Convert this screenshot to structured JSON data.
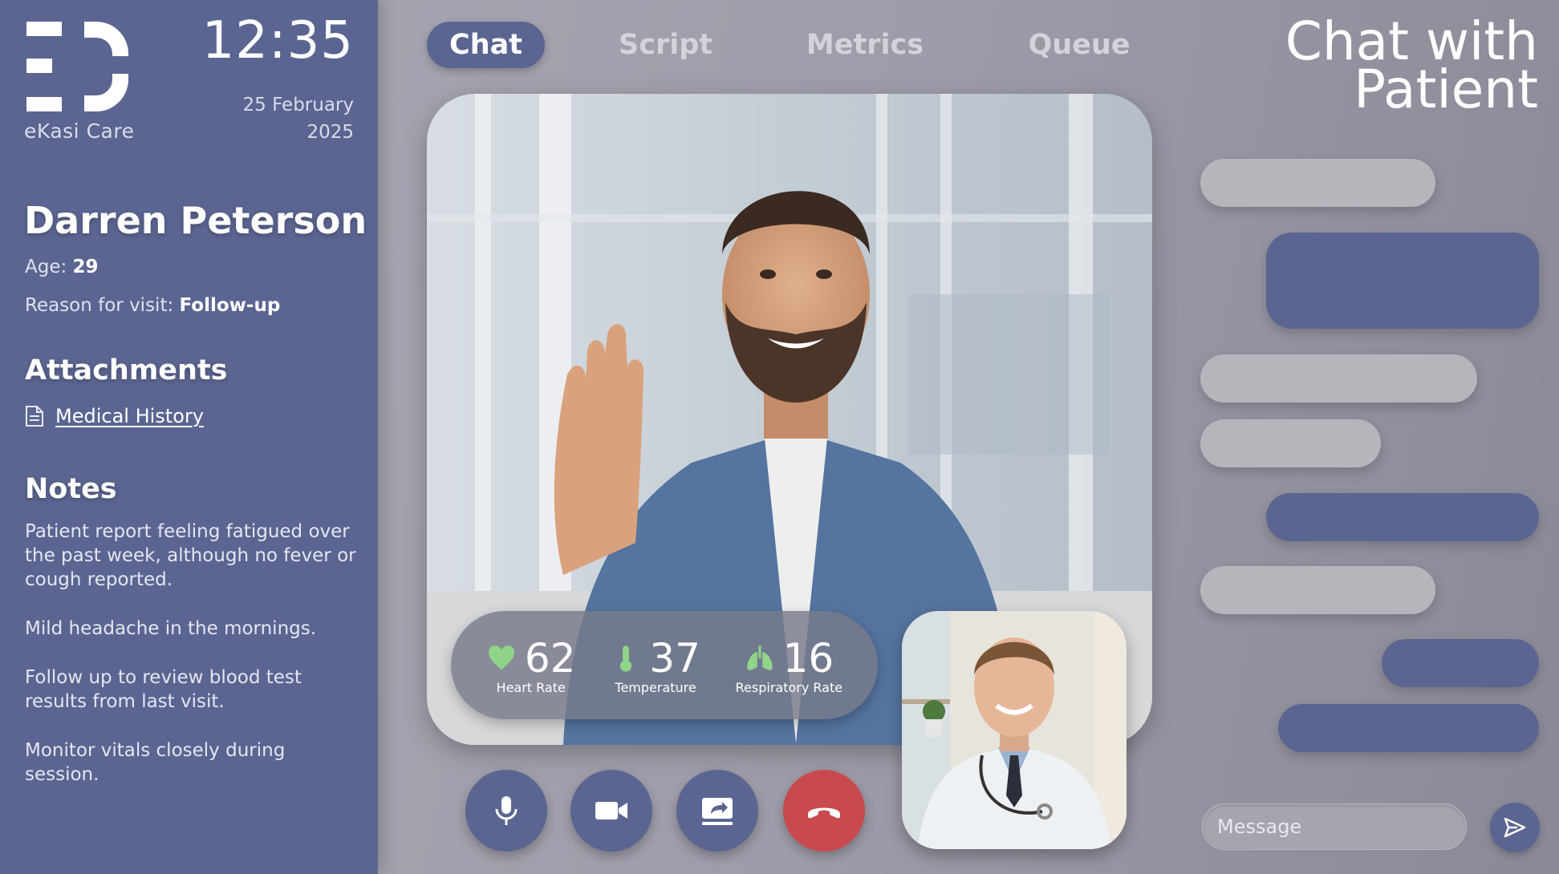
{
  "brand": {
    "name": "eKasi Care"
  },
  "clock": {
    "time": "12:35",
    "date_line1": "25 February",
    "date_line2": "2025"
  },
  "patient": {
    "name": "Darren Peterson",
    "age_label": "Age:",
    "age": "29",
    "reason_label": "Reason for visit:",
    "reason": "Follow-up"
  },
  "attachments": {
    "title": "Attachments",
    "items": [
      {
        "label": "Medical History",
        "icon": "document-icon"
      }
    ]
  },
  "notes": {
    "title": "Notes",
    "items": [
      "Patient report feeling fatigued over the past week, although no fever or cough reported.",
      "Mild headache in the mornings.",
      "Follow up to review blood test results from last visit.",
      "Monitor vitals closely during session."
    ]
  },
  "tabs": [
    {
      "label": "Chat",
      "active": true
    },
    {
      "label": "Script",
      "active": false
    },
    {
      "label": "Metrics",
      "active": false
    },
    {
      "label": "Queue",
      "active": false
    }
  ],
  "page_title": {
    "line1": "Chat with",
    "line2": "Patient"
  },
  "vitals": [
    {
      "label": "Heart Rate",
      "value": "62",
      "icon": "heart-icon"
    },
    {
      "label": "Temperature",
      "value": "37",
      "icon": "thermometer-icon"
    },
    {
      "label": "Respiratory Rate",
      "value": "16",
      "icon": "lungs-icon"
    }
  ],
  "controls": [
    {
      "name": "microphone",
      "icon": "microphone-icon"
    },
    {
      "name": "camera",
      "icon": "video-camera-icon"
    },
    {
      "name": "share-screen",
      "icon": "share-screen-icon"
    },
    {
      "name": "end-call",
      "icon": "hang-up-icon"
    }
  ],
  "chat": {
    "input_placeholder": "Message",
    "send_icon": "send-icon"
  },
  "colors": {
    "sidebar": "#5b6591",
    "accent": "#5b6591",
    "end_call": "#c94a4e",
    "vitals_green": "#8fd489",
    "incoming_bubble": "#b6b5bc"
  }
}
